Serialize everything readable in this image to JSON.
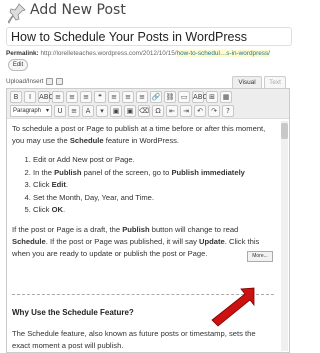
{
  "header": {
    "title": "Add New Post",
    "icon": "pushpin-icon"
  },
  "post": {
    "title": "How to Schedule Your Posts in WordPress",
    "permalink_label": "Permalink:",
    "permalink_base": "http://lorelleteaches.wordpress.com/2012/10/15/",
    "permalink_slug": "how-to-schedul…s-in-wordpress/",
    "edit_label": "Edit"
  },
  "media": {
    "label": "Upload/Insert"
  },
  "editor": {
    "tabs": [
      {
        "label": "Visual",
        "active": true
      },
      {
        "label": "Text",
        "active": false
      }
    ],
    "toolbar_row1": [
      "B",
      "I",
      "ABC",
      "≡",
      "≡",
      "≡",
      "❝",
      "≡",
      "≡",
      "≡",
      "🔗",
      "⛓",
      "▭",
      "ABC",
      "⊞",
      "▦"
    ],
    "format_select": "Paragraph",
    "toolbar_row2": [
      "U",
      "≡",
      "A",
      "▾",
      "▣",
      "▣",
      "⌫",
      "Ω",
      "⇤",
      "⇥",
      "↶",
      "↷",
      "?"
    ],
    "content": {
      "intro_a": "To schedule a post or Page to publish at a time before or after this moment, you may use the ",
      "intro_strong": "Schedule",
      "intro_b": " feature in WordPress.",
      "steps": [
        {
          "a": "Edit or Add New post or Page.",
          "b": "",
          "c": "",
          "d": ""
        },
        {
          "a": "In the ",
          "b": "Publish",
          "c": " panel of the screen, go to ",
          "d": "Publish immediately"
        },
        {
          "a": "Click ",
          "b": "Edit",
          "c": ".",
          "d": ""
        },
        {
          "a": "Set the Month, Day, Year, and Time.",
          "b": "",
          "c": "",
          "d": ""
        },
        {
          "a": "Click ",
          "b": "OK",
          "c": ".",
          "d": ""
        }
      ],
      "para2_a": "If the post or Page is a draft, the ",
      "para2_b": "Publish",
      "para2_c": " button will change to read ",
      "para2_d": "Schedule",
      "para2_e": ". If the post or Page was published, it will say ",
      "para2_f": "Update",
      "para2_g": ". Click this when you are ready to update or publish the post or Page.",
      "more_label": "More...",
      "heading": "Why Use the Schedule Feature?",
      "para3": "The Schedule feature, also known as future posts or timestamp, sets the exact moment a post will publish."
    }
  },
  "colors": {
    "accent": "#21759b",
    "arrow": "#cc1111",
    "toolbar_bg": "#ededed"
  }
}
